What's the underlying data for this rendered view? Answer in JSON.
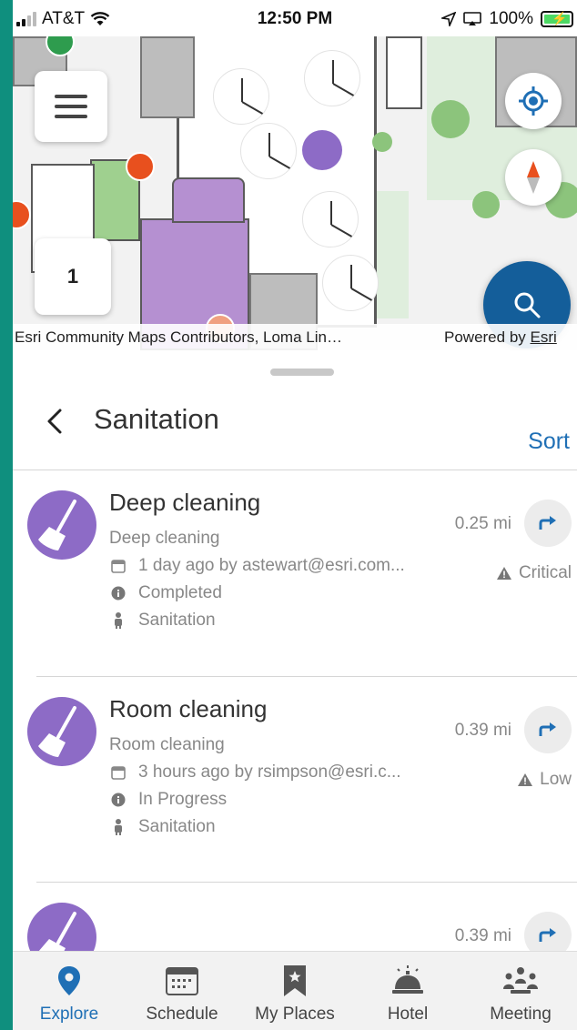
{
  "status_bar": {
    "carrier": "AT&T",
    "time": "12:50 PM",
    "battery": "100%"
  },
  "map": {
    "floor_label": "1",
    "attribution": "Esri Community Maps Contributors, Loma Lin…",
    "powered_by_prefix": "Powered by ",
    "powered_by_link": "Esri"
  },
  "panel": {
    "title": "Sanitation",
    "sort_label": "Sort"
  },
  "items": [
    {
      "name": "Deep cleaning",
      "subtitle": "Deep cleaning",
      "updated": "1 day ago by astewart@esri.com...",
      "status": "Completed",
      "category": "Sanitation",
      "distance": "0.25 mi",
      "priority": "Critical"
    },
    {
      "name": "Room cleaning",
      "subtitle": "Room cleaning",
      "updated": "3 hours ago by rsimpson@esri.c...",
      "status": "In Progress",
      "category": "Sanitation",
      "distance": "0.39 mi",
      "priority": "Low"
    },
    {
      "distance": "0.39 mi"
    }
  ],
  "tabs": [
    {
      "label": "Explore",
      "icon": "location-pin-icon"
    },
    {
      "label": "Schedule",
      "icon": "calendar-icon"
    },
    {
      "label": "My Places",
      "icon": "bookmark-icon"
    },
    {
      "label": "Hotel",
      "icon": "service-bell-icon"
    },
    {
      "label": "Meeting",
      "icon": "meeting-people-icon"
    }
  ],
  "colors": {
    "accent": "#1f6fb5",
    "fab": "#145e9a",
    "category_purple": "#8d6bc6",
    "background_edge": "#0f8f7e"
  }
}
